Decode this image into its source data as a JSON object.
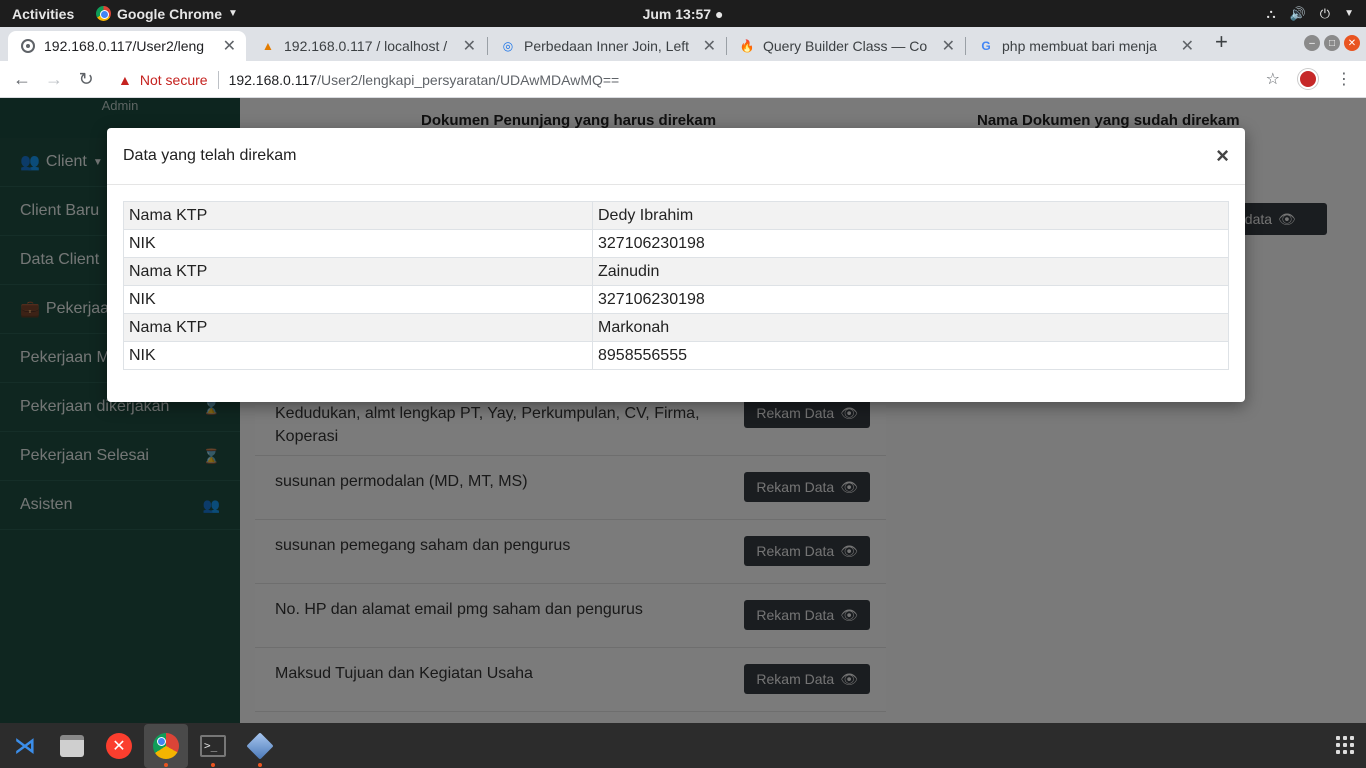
{
  "os": {
    "activities": "Activities",
    "app_name": "Google Chrome",
    "clock": "Jum 13:57"
  },
  "browser": {
    "tabs": [
      {
        "title": "192.168.0.117/User2/leng",
        "active": true
      },
      {
        "title": "192.168.0.117 / localhost /"
      },
      {
        "title": "Perbedaan Inner Join, Left"
      },
      {
        "title": "Query Builder Class — Co"
      },
      {
        "title": "php membuat bari menja"
      }
    ],
    "security_label": "Not secure",
    "url_host": "192.168.0.117",
    "url_path": "/User2/lengkapi_persyaratan/UDAwMDAwMQ=="
  },
  "sidebar": {
    "user_role": "Admin",
    "items": [
      {
        "label": "Client"
      },
      {
        "label": "Client Baru"
      },
      {
        "label": "Data Client"
      },
      {
        "label": "Pekerjaan"
      },
      {
        "label": "Pekerjaan M"
      },
      {
        "label": "Pekerjaan dikerjakan"
      },
      {
        "label": "Pekerjaan Selesai"
      },
      {
        "label": "Asisten"
      }
    ]
  },
  "main": {
    "col_left_header": "Dokumen Penunjang yang harus direkam",
    "col_right_header": "Nama Dokumen yang sudah direkam",
    "view_button_label": "t data",
    "rekam_label": "Rekam Data",
    "documents": [
      {
        "label": "Kedudukan, almt lengkap PT, Yay, Perkumpulan, CV, Firma, Koperasi"
      },
      {
        "label": "susunan permodalan (MD, MT, MS)"
      },
      {
        "label": "susunan pemegang saham dan pengurus"
      },
      {
        "label": "No. HP dan alamat email pmg saham dan pengurus"
      },
      {
        "label": "Maksud Tujuan dan Kegiatan Usaha"
      }
    ]
  },
  "modal": {
    "title": "Data yang telah direkam",
    "close_label": "×",
    "rows": [
      {
        "key": "Nama KTP",
        "value": "Dedy Ibrahim"
      },
      {
        "key": "NIK",
        "value": "327106230198"
      },
      {
        "key": "Nama KTP",
        "value": "Zainudin"
      },
      {
        "key": "NIK",
        "value": "327106230198"
      },
      {
        "key": "Nama KTP",
        "value": "Markonah"
      },
      {
        "key": "NIK",
        "value": "8958556555"
      }
    ]
  },
  "colors": {
    "sidebar_bg": "#1f4c40",
    "button_dark": "#343a40",
    "warning_red": "#c5221f"
  }
}
